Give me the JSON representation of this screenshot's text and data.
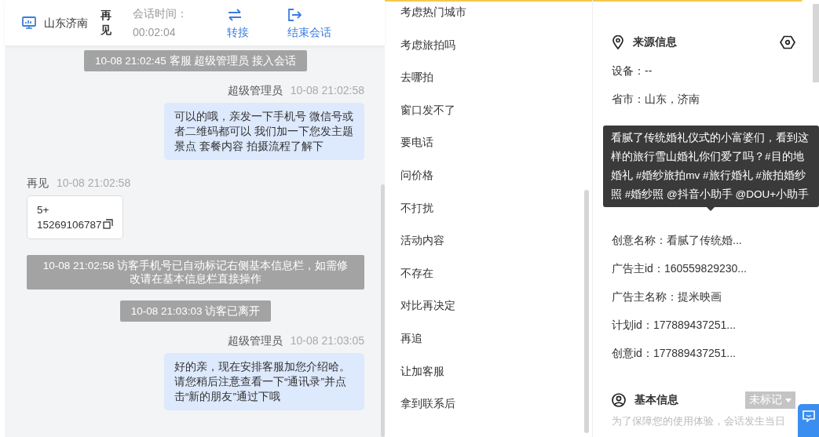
{
  "header": {
    "location": "山东济南",
    "visitor": "再见",
    "session_time_label": "会话时间：",
    "session_time": "00:02:04",
    "actions": [
      {
        "label": "转接",
        "kind": "transfer"
      },
      {
        "label": "结束会话",
        "kind": "end"
      }
    ]
  },
  "messages": [
    {
      "kind": "system",
      "text": "10-08 21:02:45 客服 超级管理员 接入会话"
    },
    {
      "kind": "agent",
      "sender": "超级管理员",
      "time": "10-08 21:02:58",
      "text": "可以的哦，亲发一下手机号 微信号或者二维码都可以 我们加一下您发主题景点 套餐内容 拍摄流程了解下"
    },
    {
      "kind": "visitor",
      "sender": "再见",
      "time": "10-08 21:02:58",
      "text": "5+\n15269106787"
    },
    {
      "kind": "system",
      "text": "10-08 21:02:58 访客手机号已自动标记右侧基本信息栏，如需修改请在基本信息栏直接操作"
    },
    {
      "kind": "system",
      "text": "10-08 21:03:03 访客已离开"
    },
    {
      "kind": "agent",
      "sender": "超级管理员",
      "time": "10-08 21:03:05",
      "text": "好的亲，现在安排客服加您介绍哈。请您稍后注意查看一下“通讯录”并点击“新的朋友”通过下哦"
    }
  ],
  "quick_replies": [
    "考虑热门城市",
    "考虑旅拍吗",
    "去哪拍",
    "窗口发不了",
    "要电话",
    "问价格",
    "不打扰",
    "活动内容",
    "不存在",
    "对比再决定",
    "再追",
    "让加客服",
    "拿到联系后"
  ],
  "source_info": {
    "title": "来源信息",
    "fields_top": [
      "设备：--",
      "省市：山东，济南"
    ],
    "fields_bottom": [
      "创意名称：看腻了传统婚...",
      "广告主id：160559829230...",
      "广告主名称：提米映画",
      "计划id：177889437251...",
      "创意id：177889437251..."
    ]
  },
  "tooltip": {
    "text": "看腻了传统婚礼仪式的小富婆们，看到这样的旅行雪山婚礼你们爱了吗？#目的地婚礼 #婚纱旅拍mv #旅行婚礼 #旅拍婚纱照 #婚纱照 @抖音小助手 @DOU+小助手"
  },
  "basic_info": {
    "title": "基本信息",
    "tag": "未标记",
    "notice": "为了保障您的使用体验，会话发生当日"
  }
}
